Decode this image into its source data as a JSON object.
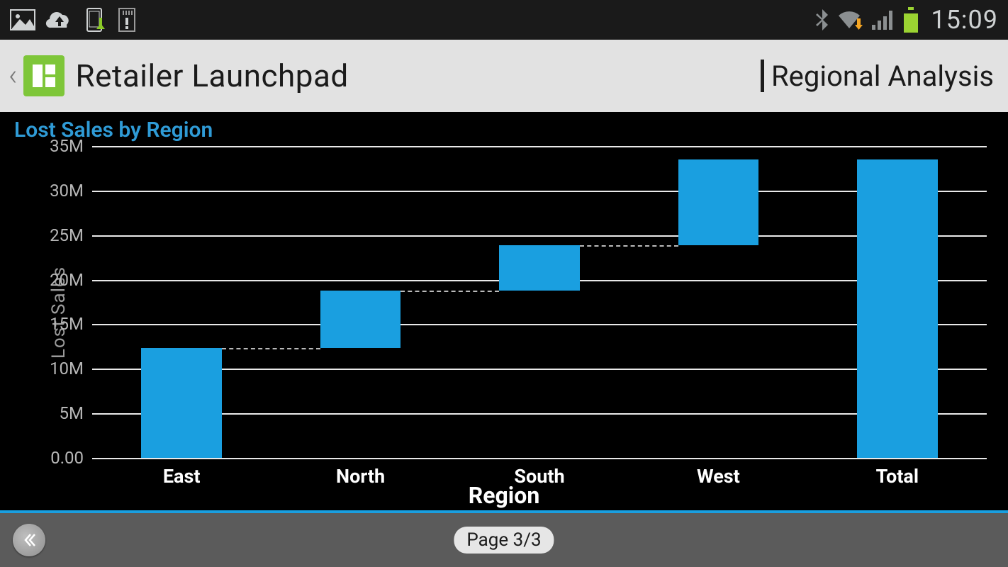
{
  "status_bar": {
    "clock": "15:09"
  },
  "header": {
    "app_title": "Retailer Launchpad",
    "context_title": "Regional Analysis"
  },
  "footer": {
    "page_label": "Page 3/3"
  },
  "chart_data": {
    "type": "bar",
    "subtype": "waterfall",
    "title": "Lost Sales by Region",
    "xlabel": "Region",
    "ylabel": "Lost Sales",
    "ylim": [
      0,
      35
    ],
    "yticks": [
      "0.00",
      "5M",
      "10M",
      "15M",
      "20M",
      "25M",
      "30M",
      "35M"
    ],
    "ytick_values": [
      0,
      5,
      10,
      15,
      20,
      25,
      30,
      35
    ],
    "categories": [
      "East",
      "North",
      "South",
      "West",
      "Total"
    ],
    "bars": [
      {
        "name": "East",
        "start": 0,
        "end": 12.3
      },
      {
        "name": "North",
        "start": 12.3,
        "end": 18.8
      },
      {
        "name": "South",
        "start": 18.8,
        "end": 23.9
      },
      {
        "name": "West",
        "start": 23.9,
        "end": 33.5
      },
      {
        "name": "Total",
        "start": 0,
        "end": 33.5
      }
    ],
    "colors": {
      "bar": "#1a9fe0",
      "grid": "#e9e9e9",
      "title": "#2f9bd6"
    }
  }
}
